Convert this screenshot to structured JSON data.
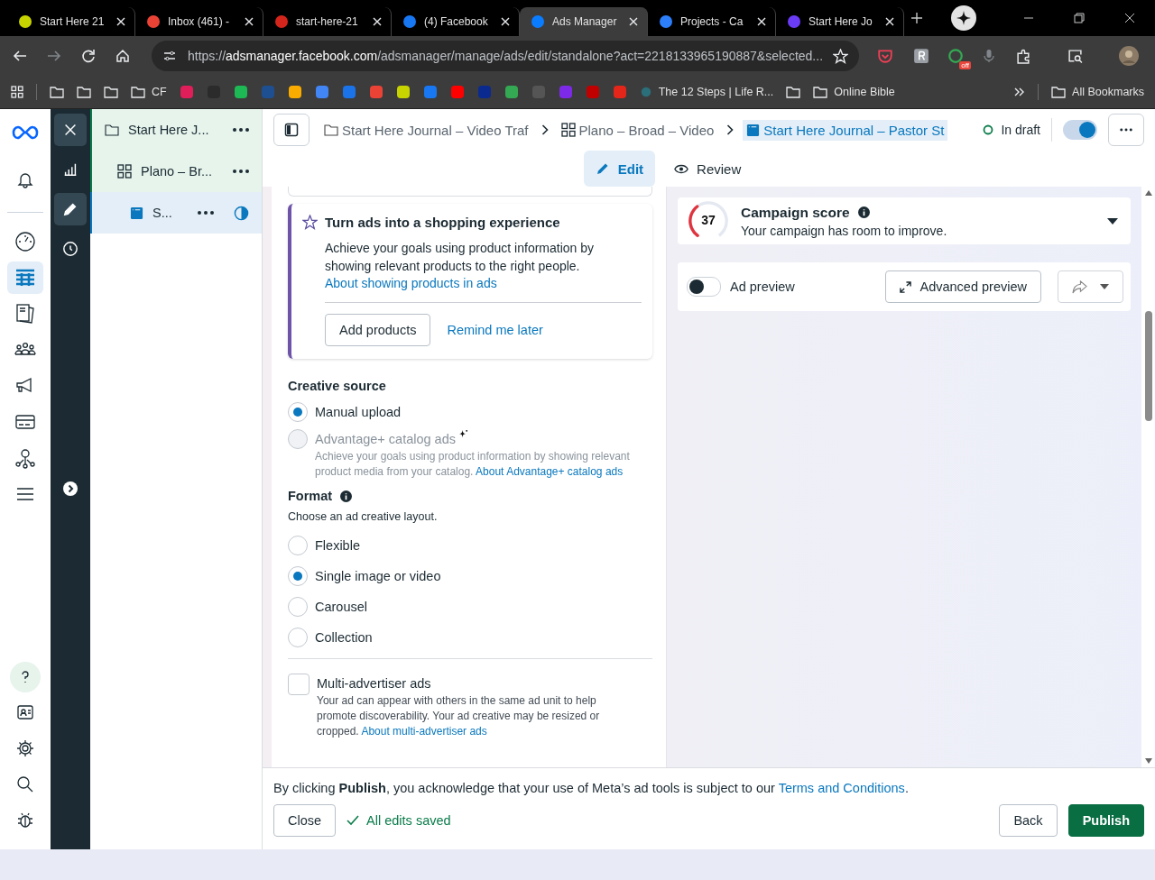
{
  "browser": {
    "tabs": [
      {
        "title": "Start Here 21",
        "selected": false,
        "color": "#c8d400"
      },
      {
        "title": "Inbox (461) -",
        "selected": false,
        "color": "#ea4335"
      },
      {
        "title": "start-here-21",
        "selected": false,
        "color": "#d4251c"
      },
      {
        "title": "(4) Facebook",
        "selected": false,
        "color": "#1877f2"
      },
      {
        "title": "Ads Manager",
        "selected": true,
        "color": "#0a7cff"
      },
      {
        "title": "Projects - Ca",
        "selected": false,
        "color": "#2d7ff9"
      },
      {
        "title": "Start Here Jo",
        "selected": false,
        "color": "#6b3cf5"
      }
    ],
    "address": {
      "scheme": "https://",
      "host": "adsmanager.facebook.com",
      "path": "/adsmanager/manage/ads/edit/standalone?act=2218133965190887&selected..."
    },
    "extension_badge": "off",
    "bookmarks": [
      {
        "kind": "folder"
      },
      {
        "kind": "folder"
      },
      {
        "kind": "folder"
      },
      {
        "kind": "folder",
        "label": "CF"
      },
      {
        "kind": "site",
        "color": "#e01e5a"
      },
      {
        "kind": "site",
        "color": "#2b2b2b"
      },
      {
        "kind": "site",
        "color": "#1db954"
      },
      {
        "kind": "site",
        "color": "#1d4f91"
      },
      {
        "kind": "site",
        "color": "#f9ab00"
      },
      {
        "kind": "site",
        "color": "#4285f4"
      },
      {
        "kind": "site",
        "color": "#1a73e8"
      },
      {
        "kind": "site",
        "color": "#ea4335"
      },
      {
        "kind": "site",
        "color": "#c8d400"
      },
      {
        "kind": "site",
        "color": "#1877f2"
      },
      {
        "kind": "site",
        "color": "#ff0000"
      },
      {
        "kind": "site",
        "color": "#0b2a8f"
      },
      {
        "kind": "site",
        "color": "#34a853"
      },
      {
        "kind": "site",
        "color": "#555555"
      },
      {
        "kind": "site",
        "color": "#7d2ae8"
      },
      {
        "kind": "site",
        "color": "#c00000"
      },
      {
        "kind": "site",
        "color": "#e32619"
      },
      {
        "kind": "link",
        "label": "The 12 Steps | Life R...",
        "color": "#2a6f7a"
      },
      {
        "kind": "folder"
      },
      {
        "kind": "folder",
        "label": "Online Bible"
      }
    ],
    "all_bookmarks": "All Bookmarks"
  },
  "left_nav": {
    "top": [
      {
        "kind": "bell",
        "selected": false
      }
    ],
    "main": [
      {
        "kind": "gauge",
        "selected": false
      },
      {
        "kind": "table",
        "selected": true
      },
      {
        "kind": "pages",
        "selected": false
      },
      {
        "kind": "people",
        "selected": false
      },
      {
        "kind": "megaphone",
        "selected": false
      },
      {
        "kind": "card",
        "selected": false
      },
      {
        "kind": "network",
        "selected": false
      },
      {
        "kind": "menu",
        "selected": false
      }
    ],
    "bottom": [
      {
        "kind": "help",
        "selected": false
      },
      {
        "kind": "profile",
        "selected": false
      },
      {
        "kind": "gear",
        "selected": false
      },
      {
        "kind": "search",
        "selected": false
      },
      {
        "kind": "bug",
        "selected": false
      }
    ]
  },
  "tools": [
    {
      "kind": "close",
      "selected": true
    },
    {
      "kind": "chart",
      "selected": false
    },
    {
      "kind": "edit",
      "selected": true
    },
    {
      "kind": "history",
      "selected": false
    }
  ],
  "tree": [
    {
      "kind": "campaign",
      "label": "Start Here J...",
      "selected": false,
      "children": [
        {
          "kind": "adset",
          "label": "Plano – Br...",
          "selected": false,
          "children": [
            {
              "kind": "ad",
              "label": "S...",
              "selected": true
            }
          ]
        }
      ]
    }
  ],
  "breadcrumbs": [
    {
      "kind": "campaign",
      "label": "Start Here Journal – Video Traf",
      "selected": false
    },
    {
      "kind": "adset",
      "label": "Plano – Broad – Video",
      "selected": false
    },
    {
      "kind": "ad",
      "label": "Start Here Journal – Pastor St",
      "selected": true
    }
  ],
  "status": "In draft",
  "published_toggle": {
    "on": true
  },
  "modes": [
    {
      "kind": "edit",
      "label": "Edit",
      "selected": true
    },
    {
      "kind": "review",
      "label": "Review",
      "selected": false
    }
  ],
  "shopping_card": {
    "title": "Turn ads into a shopping experience",
    "body": "Achieve your goals using product information by showing relevant products to the right people.",
    "link": "About showing products in ads",
    "primary": "Add products",
    "secondary": "Remind me later"
  },
  "creative_source": {
    "title": "Creative source",
    "options": [
      {
        "label": "Manual upload",
        "selected": true,
        "disabled": false
      },
      {
        "label": "Advantage+ catalog ads",
        "selected": false,
        "disabled": true,
        "description": "Achieve your goals using product information by showing relevant product media from your catalog.",
        "link": "About Advantage+ catalog ads"
      }
    ]
  },
  "format": {
    "title": "Format",
    "subtitle": "Choose an ad creative layout.",
    "options": [
      {
        "label": "Flexible",
        "selected": false
      },
      {
        "label": "Single image or video",
        "selected": true
      },
      {
        "label": "Carousel",
        "selected": false
      },
      {
        "label": "Collection",
        "selected": false
      }
    ]
  },
  "multi_advertiser": {
    "label": "Multi-advertiser ads",
    "checked": false,
    "description": "Your ad can appear with others in the same ad unit to help promote discoverability. Your ad creative may be resized or cropped.",
    "link": "About multi-advertiser ads"
  },
  "campaign_score": {
    "score": "37",
    "level": 0.37,
    "title": "Campaign score",
    "subtitle": "Your campaign has room to improve."
  },
  "ad_preview": {
    "label": "Ad preview",
    "on": false,
    "advanced": "Advanced preview"
  },
  "footer": {
    "notice": "By clicking **Publish**, you acknowledge that your use of Meta’s ad tools is subject to our ",
    "link": "Terms and Conditions",
    "notice_end": ".",
    "close": "Close",
    "saved": "All edits saved",
    "back": "Back",
    "publish": "Publish"
  }
}
